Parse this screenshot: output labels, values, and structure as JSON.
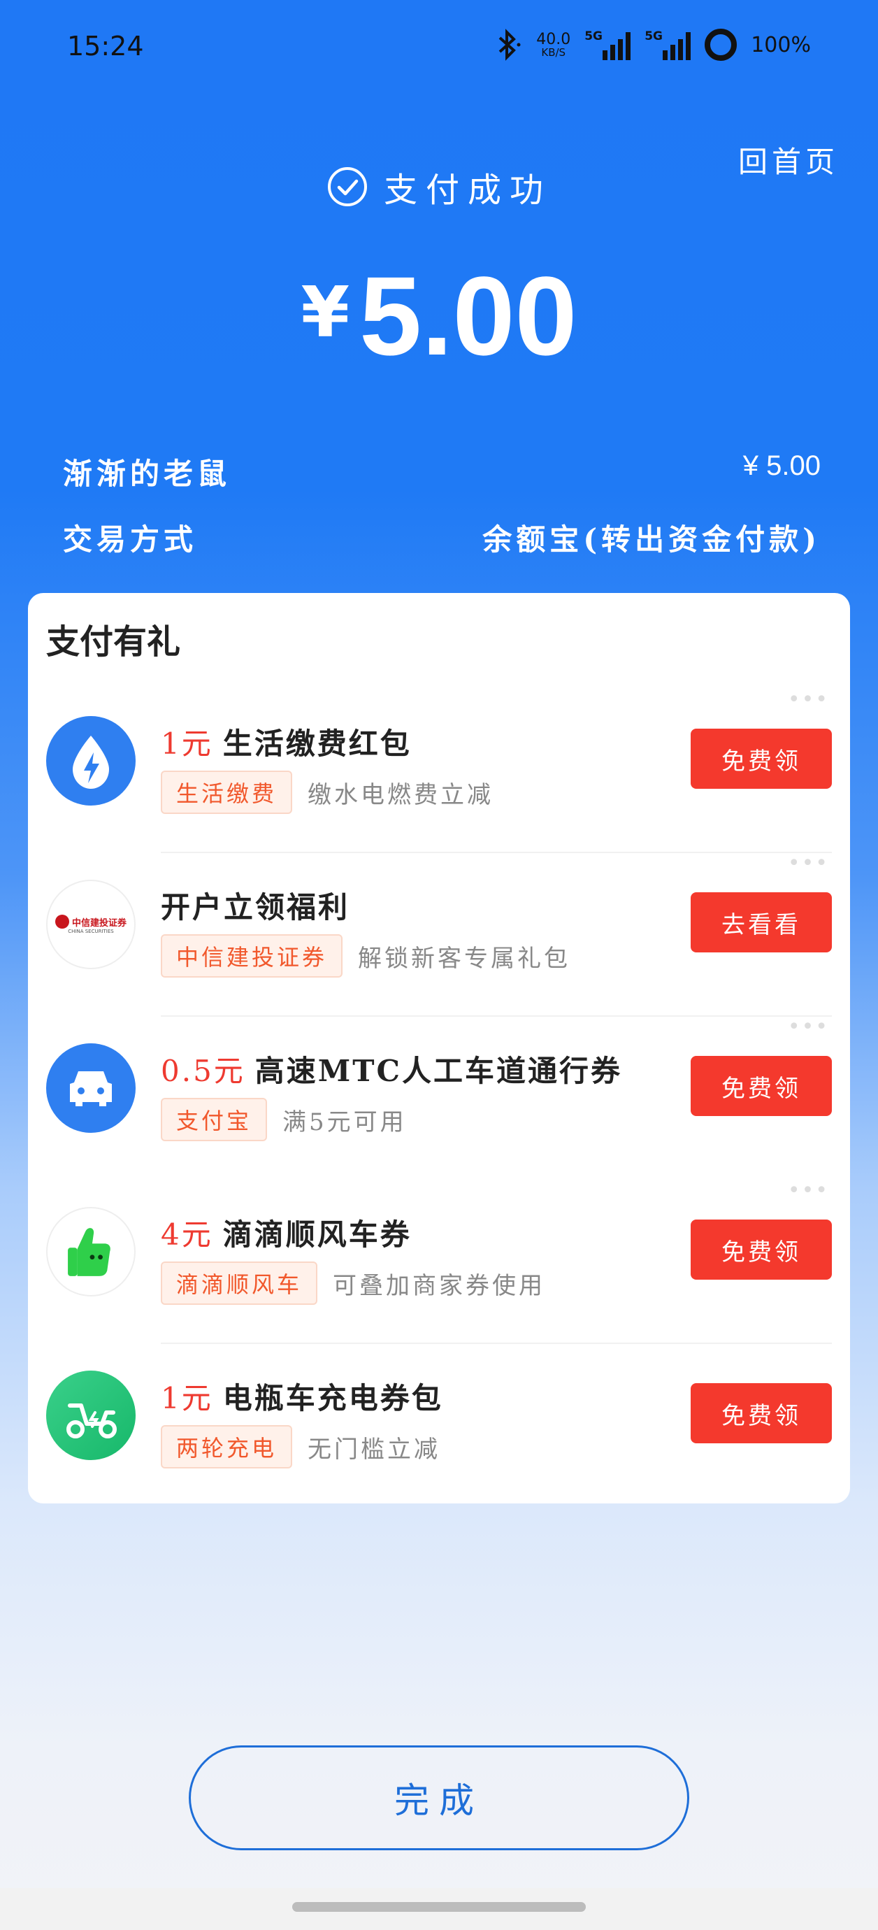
{
  "status_bar": {
    "time": "15:24",
    "net_speed_value": "40.0",
    "net_speed_unit": "KB/S",
    "signal1_label": "5G",
    "signal2_label": "5G",
    "battery": "100%"
  },
  "header": {
    "home_link": "回首页",
    "status": "支付成功",
    "currency_symbol": "¥",
    "amount": "5.00"
  },
  "info": {
    "payee": "渐渐的老鼠",
    "payee_amount": "¥ 5.00",
    "method_label": "交易方式",
    "method_value": "余额宝(转出资金付款)"
  },
  "rewards": {
    "title": "支付有礼",
    "items": [
      {
        "money": "1元",
        "title": "生活缴费红包",
        "tag": "生活缴费",
        "desc": "缴水电燃费立减",
        "button": "免费领",
        "icon": "lightning-icon"
      },
      {
        "money": "",
        "title": "开户立领福利",
        "tag": "中信建投证券",
        "desc": "解锁新客专属礼包",
        "button": "去看看",
        "icon": "china-securities-logo",
        "logo_text": "中信建投证券",
        "logo_sub": "CHINA SECURITIES"
      },
      {
        "money": "0.5元",
        "title": "高速MTC人工车道通行券",
        "tag": "支付宝",
        "desc": "满5元可用",
        "button": "免费领",
        "icon": "car-icon"
      },
      {
        "money": "4元",
        "title": "滴滴顺风车券",
        "tag": "滴滴顺风车",
        "desc": "可叠加商家券使用",
        "button": "免费领",
        "icon": "thumbs-up-icon"
      },
      {
        "money": "1元",
        "title": "电瓶车充电券包",
        "tag": "两轮充电",
        "desc": "无门槛立减",
        "button": "免费领",
        "icon": "scooter-icon"
      }
    ]
  },
  "footer": {
    "done_label": "完成"
  },
  "colors": {
    "brand_blue": "#1f78f5",
    "button_red": "#f4392d",
    "money_red": "#ee3a30",
    "tag_orange": "#f1582c"
  }
}
